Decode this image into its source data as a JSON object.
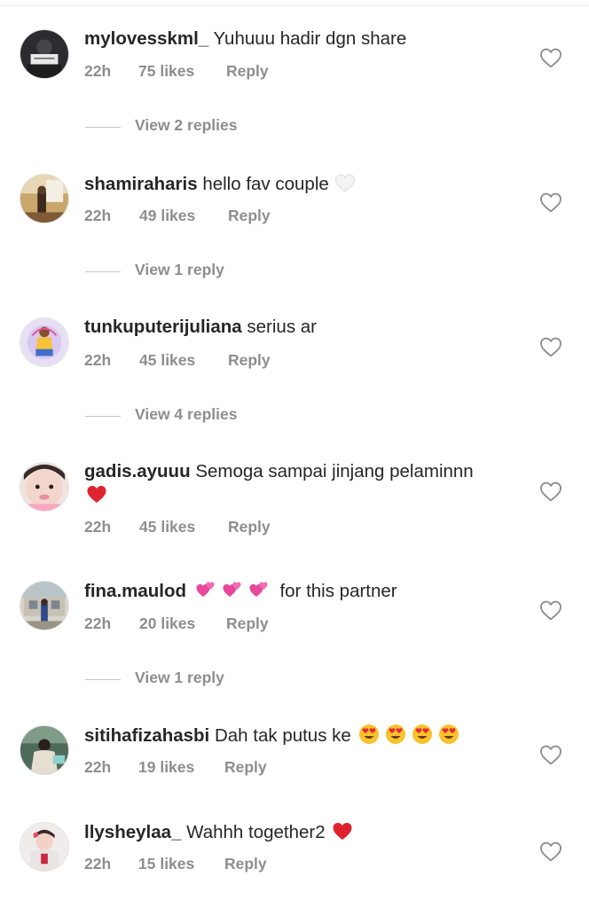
{
  "comments": [
    {
      "username": "mylovesskml_",
      "text": "Yuhuuu hadir dgn share",
      "time": "22h",
      "likes": "75 likes",
      "reply": "Reply",
      "view_replies": "View 2 replies"
    },
    {
      "username": "shamiraharis",
      "text": "hello fav couple",
      "emoji": "white-heart",
      "time": "22h",
      "likes": "49 likes",
      "reply": "Reply",
      "view_replies": "View 1 reply"
    },
    {
      "username": "tunkuputerijuliana",
      "text": "serius ar",
      "time": "22h",
      "likes": "45 likes",
      "reply": "Reply",
      "view_replies": "View 4 replies"
    },
    {
      "username": "gadis.ayuuu",
      "text": "Semoga sampai jinjang pelaminnn",
      "emoji": "red-heart",
      "time": "22h",
      "likes": "45 likes",
      "reply": "Reply"
    },
    {
      "username": "fina.maulod",
      "text": "for this partner",
      "emoji": "revolving-hearts x3",
      "time": "22h",
      "likes": "20 likes",
      "reply": "Reply",
      "view_replies": "View 1 reply"
    },
    {
      "username": "sitihafizahasbi",
      "text": "Dah tak putus ke",
      "emoji": "heart-eyes x4",
      "time": "22h",
      "likes": "19 likes",
      "reply": "Reply"
    },
    {
      "username": "llysheylaa_",
      "text": "Wahhh together2",
      "emoji": "red-heart",
      "time": "22h",
      "likes": "15 likes",
      "reply": "Reply"
    }
  ],
  "colors": {
    "text": "#262626",
    "meta": "#8e8e8e",
    "heart_outline": "#8e8e8e"
  },
  "icons": {
    "like": "heart-outline-icon"
  }
}
